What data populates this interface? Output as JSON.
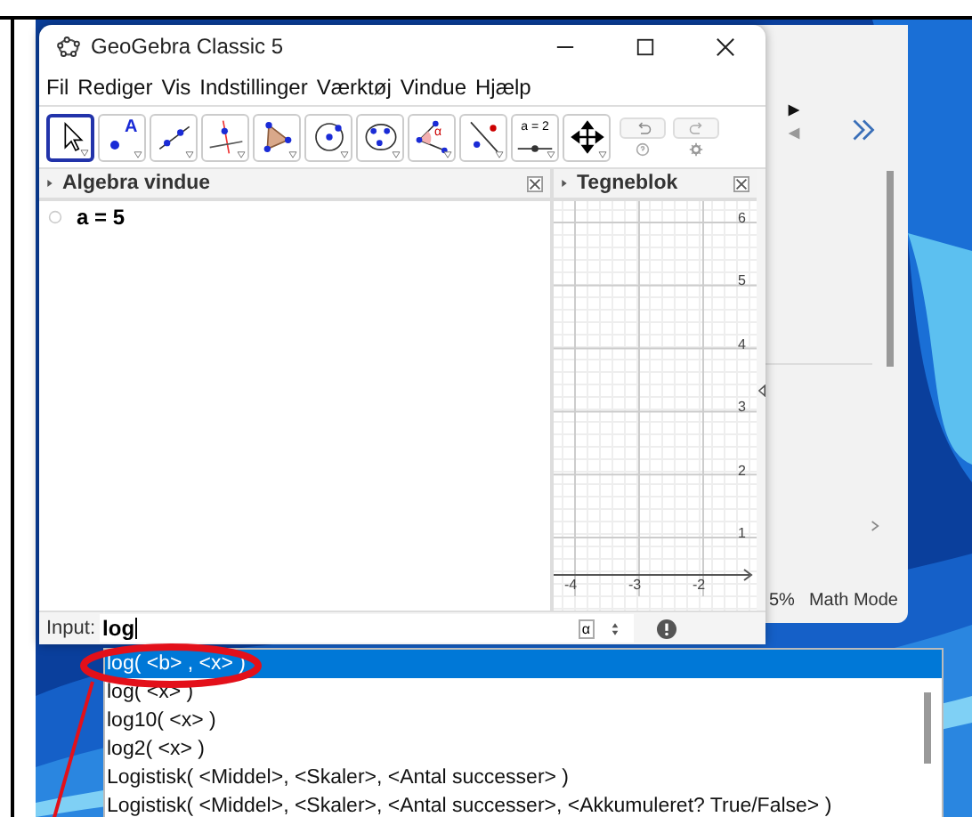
{
  "window": {
    "title": "GeoGebra Classic 5"
  },
  "menu": [
    "Fil",
    "Rediger",
    "Vis",
    "Indstillinger",
    "Værktøj",
    "Vindue",
    "Hjælp"
  ],
  "tools": [
    {
      "kind": "move",
      "selected": true
    },
    {
      "kind": "point",
      "selected": false,
      "label": "A"
    },
    {
      "kind": "line",
      "selected": false
    },
    {
      "kind": "perpendicular",
      "selected": false
    },
    {
      "kind": "polygon",
      "selected": false
    },
    {
      "kind": "circle",
      "selected": false
    },
    {
      "kind": "conic",
      "selected": false
    },
    {
      "kind": "angle",
      "selected": false,
      "label": "α"
    },
    {
      "kind": "reflect",
      "selected": false
    },
    {
      "kind": "slider",
      "selected": false,
      "label": "a = 2"
    },
    {
      "kind": "move-view",
      "selected": false
    }
  ],
  "algebra": {
    "title": "Algebra vindue",
    "items": [
      {
        "text": "a = 5"
      }
    ]
  },
  "graphics": {
    "title": "Tegneblok",
    "y_labels": [
      "6",
      "5",
      "4",
      "3",
      "2",
      "1"
    ],
    "x_labels": [
      "-4",
      "-3",
      "-2"
    ]
  },
  "input": {
    "label": "Input:",
    "value": "log",
    "symbol": "α"
  },
  "suggestions": [
    {
      "text": "log( <b> , <x> )",
      "selected": true
    },
    {
      "text": "log( <x> )",
      "selected": false
    },
    {
      "text": "log10( <x> )",
      "selected": false
    },
    {
      "text": "log2( <x> )",
      "selected": false
    },
    {
      "text": "Logistisk( <Middel>, <Skaler>, <Antal successer> )",
      "selected": false
    },
    {
      "text": "Logistisk( <Middel>, <Skaler>, <Antal successer>, <Akkumuleret? True/False> )",
      "selected": false
    }
  ],
  "side_window": {
    "zoom": "5%",
    "mode": "Math Mode"
  }
}
